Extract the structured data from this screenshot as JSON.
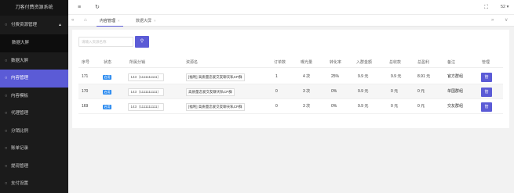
{
  "app": {
    "title": "刀客付费资源系统"
  },
  "sidebar": {
    "parent": {
      "label": "付费资源管理",
      "arrow": "▲"
    },
    "sub": {
      "label": "数据大屏"
    },
    "items": [
      {
        "label": "数据大屏"
      },
      {
        "label": "内容管理"
      },
      {
        "label": "内容模板"
      },
      {
        "label": "代理管理"
      },
      {
        "label": "分销比例"
      },
      {
        "label": "账单记录"
      },
      {
        "label": "提现管理"
      },
      {
        "label": "支付设置"
      }
    ]
  },
  "topbar": {
    "menu_icon": "≡",
    "refresh_icon": "↻",
    "fullscreen_icon": "⛶",
    "user": "52 ▾"
  },
  "tabs": {
    "prev": "«",
    "home": "⌂",
    "items": [
      {
        "label": "内容管理"
      },
      {
        "label": "数据大屏"
      }
    ],
    "close": "×",
    "next": "»",
    "menu": "∨"
  },
  "search": {
    "placeholder": "请输入资源名称",
    "icon": "⚲"
  },
  "table": {
    "columns": [
      "序号",
      "状态",
      "所属分销",
      "资源名",
      "订单数",
      "曝光量",
      "转化率",
      "入群金额",
      "总收款",
      "总盈利",
      "备注",
      "管理"
    ],
    "rows": [
      {
        "id": "171",
        "status": "启用",
        "category": "143（1111111111）",
        "name": "[福利] 高质量恋爱交友聊天私CP群",
        "orders": "1",
        "views": "4 次",
        "rate": "25%",
        "price": "9.9 元",
        "income": "9.9 元",
        "profit": "8.91 元",
        "note": "官方群组",
        "manage": "管"
      },
      {
        "id": "170",
        "status": "启用",
        "category": "143（1111111111）",
        "name": "高质量恋爱交友聊天私CP群",
        "orders": "0",
        "views": "3 次",
        "rate": "0%",
        "price": "9.9 元",
        "income": "0 元",
        "profit": "0 元",
        "note": "单国群组",
        "manage": "管"
      },
      {
        "id": "169",
        "status": "启用",
        "category": "143（1111111111）",
        "name": "[福利] 高质量恋爱交友聊天私CP群",
        "orders": "0",
        "views": "3 次",
        "rate": "0%",
        "price": "9.9 元",
        "income": "0 元",
        "profit": "0 元",
        "note": "交友群组",
        "manage": "管"
      }
    ]
  },
  "colors": {
    "accent": "#5b5bd6",
    "sidebar_bg": "#1b1b1b",
    "status_blue": "#2d8cf0"
  }
}
